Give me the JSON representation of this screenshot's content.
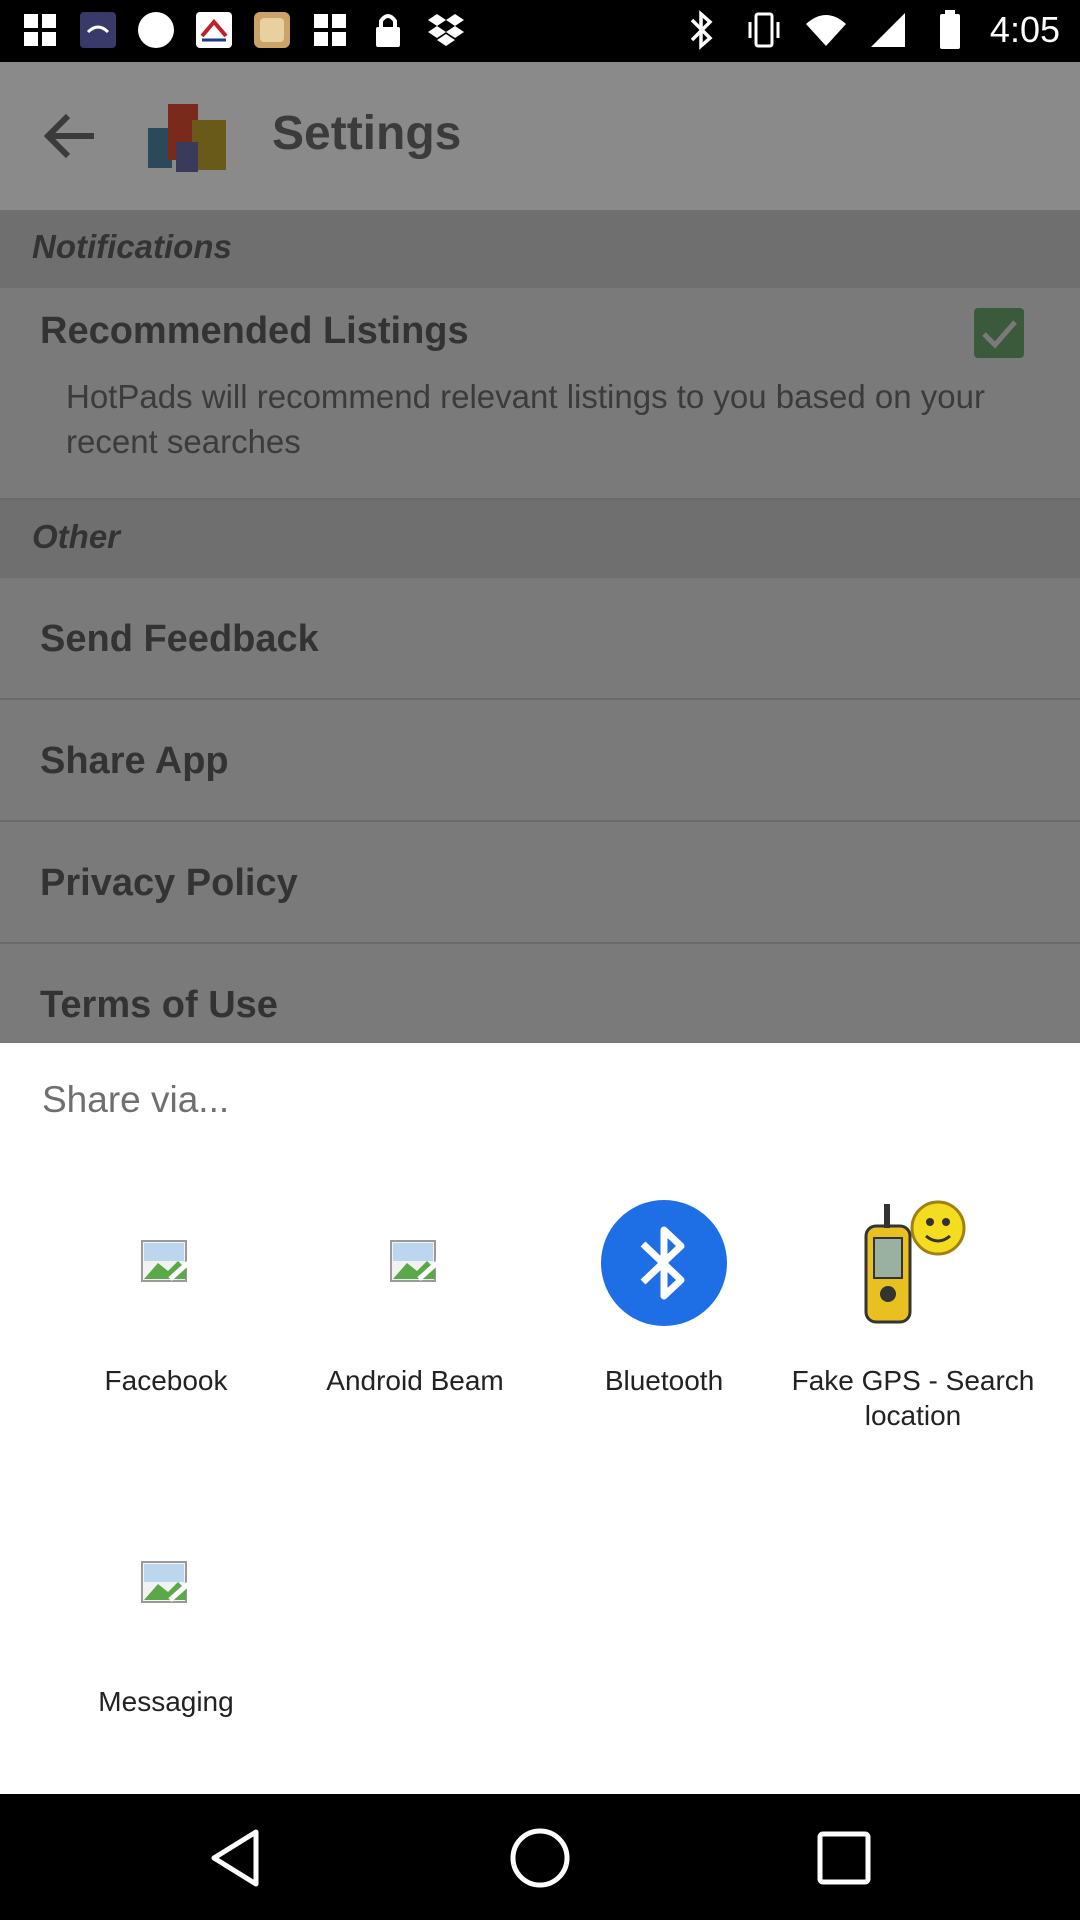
{
  "status_bar": {
    "time": "4:05",
    "left_icons": [
      "grid-icon",
      "sarah-yasin-app-icon",
      "circle-icon",
      "mas-app-icon",
      "photo-app-icon",
      "grid-icon",
      "lock-icon",
      "dropbox-icon"
    ],
    "right_icons": [
      "bluetooth-icon",
      "vibrate-icon",
      "wifi-icon",
      "signal-icon",
      "battery-icon"
    ]
  },
  "app_bar": {
    "title": "Settings",
    "back_icon": "arrow-back-icon",
    "logo_icon": "hotpads-logo-icon"
  },
  "settings": {
    "notifications_header": "Notifications",
    "recommended_title": "Recommended Listings",
    "recommended_desc": "HotPads will recommend relevant listings to you based on your recent searches",
    "recommended_checked": true,
    "other_header": "Other",
    "items": [
      "Send Feedback",
      "Share App",
      "Privacy Policy",
      "Terms of Use"
    ]
  },
  "share_sheet": {
    "title": "Share via...",
    "apps": [
      {
        "label": "Facebook",
        "icon": "broken-image-icon"
      },
      {
        "label": "Android Beam",
        "icon": "broken-image-icon"
      },
      {
        "label": "Bluetooth",
        "icon": "bluetooth-icon"
      },
      {
        "label": "Fake GPS - Search location",
        "icon": "gps-device-icon"
      },
      {
        "label": "Messaging",
        "icon": "broken-image-icon"
      }
    ]
  },
  "nav_bar": {
    "buttons": [
      "back-triangle-icon",
      "home-circle-icon",
      "recents-square-icon"
    ]
  },
  "colors": {
    "bluetooth_blue": "#1e6ee6",
    "scrim_gray": "#7a7a7a"
  }
}
